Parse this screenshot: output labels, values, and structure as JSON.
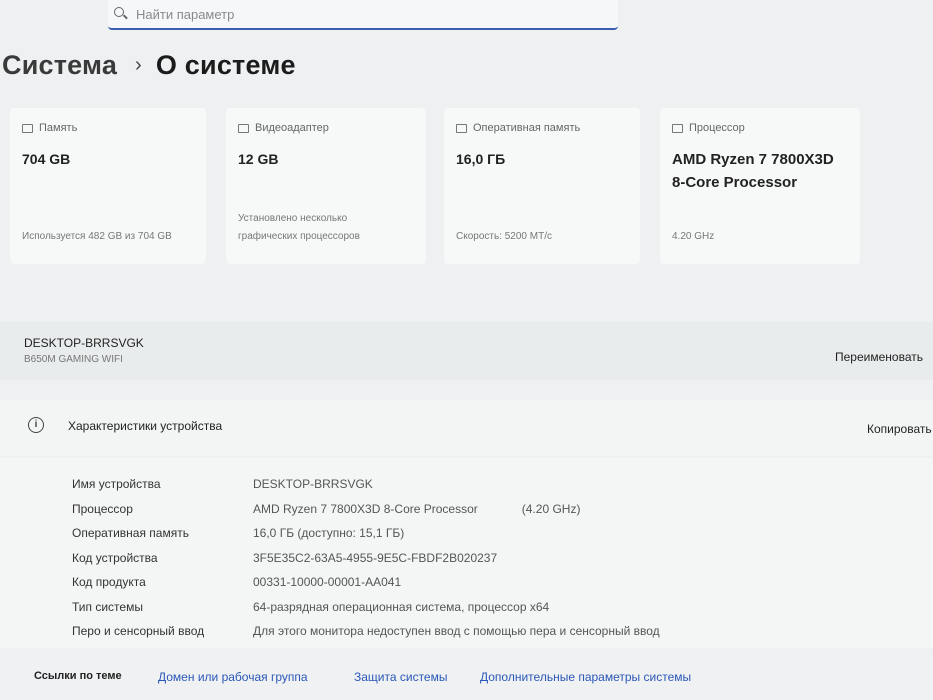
{
  "search": {
    "placeholder": "Найти параметр"
  },
  "breadcrumb": {
    "parent": "Система",
    "separator": "›",
    "current": "О системе"
  },
  "cards": {
    "storage": {
      "label": "Память",
      "value": "704 GB",
      "sub": "Используется 482 GB из 704 GB"
    },
    "gpu": {
      "label": "Видеоадаптер",
      "value": "12 GB",
      "sub": "Установлено несколько графических процессоров"
    },
    "ram": {
      "label": "Оперативная память",
      "value": "16,0 ГБ",
      "sub": "Скорость: 5200 МТ/с"
    },
    "cpu": {
      "label": "Процессор",
      "value": "AMD Ryzen 7 7800X3D 8-Core Processor",
      "sub": "4.20 GHz"
    }
  },
  "device": {
    "name": "DESKTOP-BRRSVGK",
    "model": "B650M GAMING WIFI",
    "rename_label": "Переименовать"
  },
  "specs": {
    "title": "Характеристики устройства",
    "copy_label": "Копировать",
    "rows": [
      {
        "label": "Имя устройства",
        "value": "DESKTOP-BRRSVGK",
        "extra": ""
      },
      {
        "label": "Процессор",
        "value": "AMD Ryzen 7 7800X3D 8-Core Processor",
        "extra": "(4.20 GHz)"
      },
      {
        "label": "Оперативная память",
        "value": "16,0 ГБ (доступно: 15,1 ГБ)",
        "extra": ""
      },
      {
        "label": "Код устройства",
        "value": "3F5E35C2-63A5-4955-9E5C-FBDF2B020237",
        "extra": ""
      },
      {
        "label": "Код продукта",
        "value": "00331-10000-00001-AA041",
        "extra": ""
      },
      {
        "label": "Тип системы",
        "value": "64-разрядная операционная система, процессор x64",
        "extra": ""
      },
      {
        "label": "Перо и сенсорный ввод",
        "value": "Для этого монитора недоступен ввод с помощью пера и сенсорный ввод",
        "extra": ""
      }
    ]
  },
  "related": {
    "label": "Ссылки по теме",
    "links": [
      "Домен или рабочая группа",
      "Защита системы",
      "Дополнительные параметры системы"
    ]
  },
  "colors": {
    "accent": "#3a5fb0",
    "link": "#2b58b8"
  }
}
